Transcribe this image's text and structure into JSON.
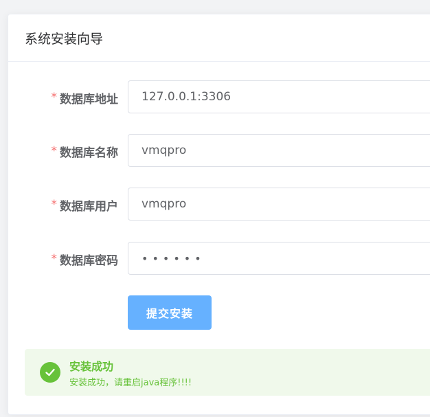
{
  "header": {
    "title": "系统安装向导"
  },
  "form": {
    "required_mark": "*",
    "fields": [
      {
        "label": "数据库地址",
        "value": "127.0.0.1:3306"
      },
      {
        "label": "数据库名称",
        "value": "vmqpro"
      },
      {
        "label": "数据库用户",
        "value": "vmqpro"
      },
      {
        "label": "数据库密码",
        "value": "••••••"
      }
    ],
    "submit_label": "提交安装"
  },
  "alert": {
    "type": "success",
    "icon": "check-circle-icon",
    "title": "安装成功",
    "description": "安装成功，请重启java程序!!!!"
  },
  "colors": {
    "required": "#f56c6c",
    "primary_light": "#66b1ff",
    "success": "#67c23a",
    "success_bg": "#f0f9eb"
  }
}
